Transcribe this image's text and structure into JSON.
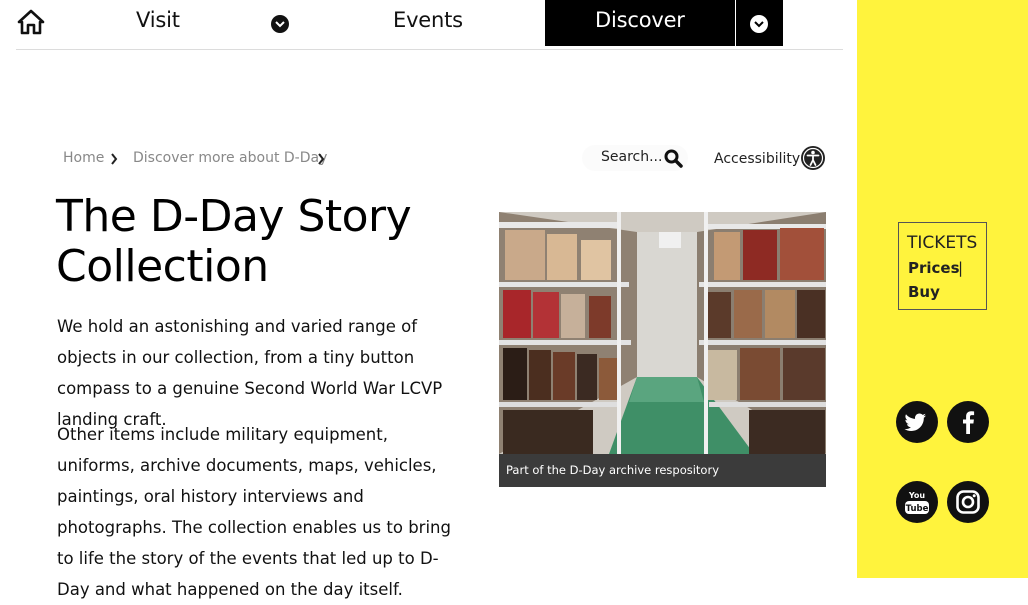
{
  "nav": {
    "home_icon": "home-icon",
    "visit_label": "Visit",
    "events_label": "Events",
    "discover_label": "Discover",
    "dropdown_icon": "chevron-down-icon"
  },
  "breadcrumb": {
    "items": [
      "Home",
      "Discover more about D-Day"
    ],
    "separator_icon": "chevron-right-icon"
  },
  "search": {
    "placeholder": "Search...",
    "icon": "search-icon"
  },
  "accessibility": {
    "label": "Accessibility",
    "icon": "accessibility-icon"
  },
  "page": {
    "title": "The D-Day Story Collection",
    "paragraphs": [
      "We hold an astonishing and varied range of objects in our collection, from a tiny button compass to a genuine Second World War LCVP landing craft.",
      "Other items include military equipment, uniforms, archive documents, maps, vehicles, paintings, oral history interviews and photographs. The collection enables us to bring to life the story of the events that led up to D-Day and what happened on the day itself."
    ]
  },
  "image": {
    "caption": "Part of the D-Day archive respository"
  },
  "sidebar": {
    "tickets_label": "TICKETS",
    "prices_label": "Prices",
    "separator": "|",
    "buy_label": "Buy",
    "social_icons": [
      "twitter-icon",
      "facebook-icon",
      "youtube-icon",
      "instagram-icon"
    ]
  },
  "colors": {
    "sidebar_yellow": "#fff33d",
    "nav_active": "#000000",
    "text": "#111111",
    "breadcrumb_gray": "#888888",
    "caption_bg": "#3b3b3b"
  }
}
